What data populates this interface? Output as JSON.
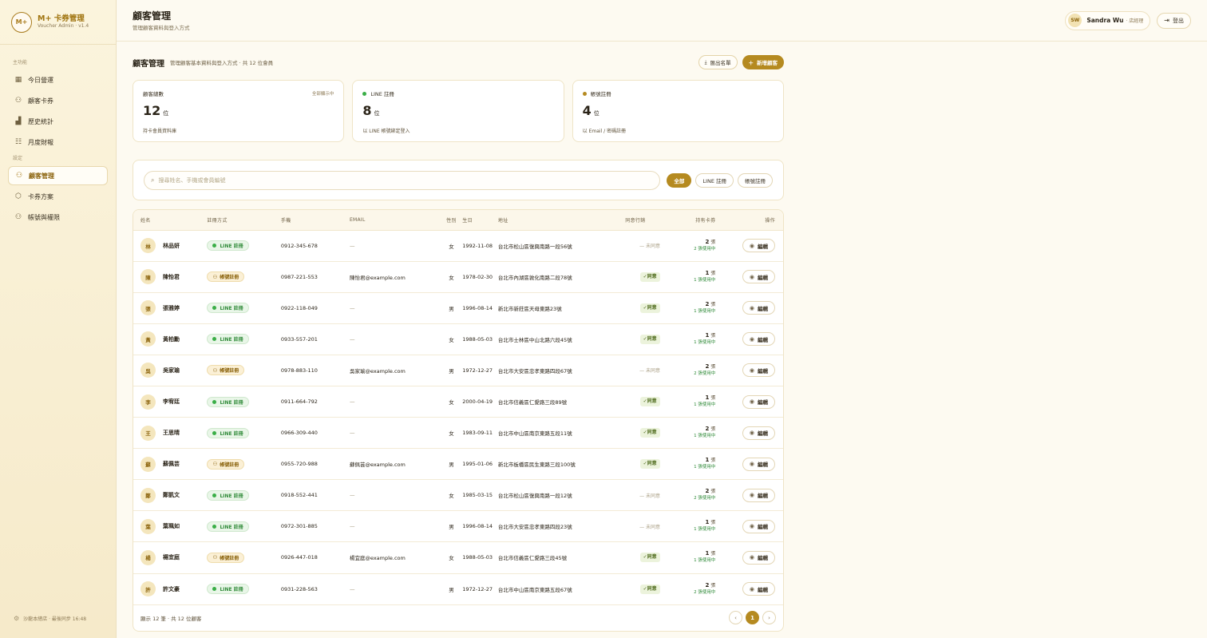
{
  "brand": {
    "logo": "M+",
    "name": "M+ 卡券管理",
    "sub": "Voucher Admin · v1.4"
  },
  "sidebar": {
    "sections": [
      {
        "title": "主功能",
        "items": [
          {
            "label": "今日營運",
            "icon": "dashboard-icon"
          },
          {
            "label": "顧客卡券",
            "icon": "users-icon"
          },
          {
            "label": "歷史統計",
            "icon": "chart-icon"
          },
          {
            "label": "月度財報",
            "icon": "report-icon"
          }
        ]
      },
      {
        "title": "設定",
        "items": [
          {
            "label": "顧客管理",
            "icon": "users-icon",
            "active": true
          },
          {
            "label": "卡券方案",
            "icon": "box-icon"
          },
          {
            "label": "帳號與權限",
            "icon": "users-icon"
          }
        ]
      }
    ],
    "footer": "沙龍本總店 · 最後同步 16:48"
  },
  "topbar": {
    "title": "顧客管理",
    "subtitle": "管理顧客資料與登入方式",
    "user_initials": "SW",
    "user_name": "Sandra Wu",
    "user_role": "· 店經理",
    "logout_label": "登出"
  },
  "section": {
    "title": "顧客管理",
    "subtitle": "管理顧客基本資料與登入方式 · 共 12 位會員",
    "export_label": "匯出名單",
    "add_label": "新增顧客"
  },
  "stats": [
    {
      "label": "顧客總數",
      "corner": "全部顯示中",
      "value": "12",
      "unit": "位",
      "desc": "持卡會員資料庫",
      "dot": ""
    },
    {
      "label": "LINE 註冊",
      "corner": "",
      "value": "8",
      "unit": "位",
      "desc": "以 LINE 帳號綁定登入",
      "dot": "#3aae47"
    },
    {
      "label": "帳號註冊",
      "corner": "",
      "value": "4",
      "unit": "位",
      "desc": "以 Email / 密碼註冊",
      "dot": "#b58a20"
    }
  ],
  "filter": {
    "search_placeholder": "搜尋姓名、手機或會員編號",
    "chips": [
      "全部",
      "LINE 註冊",
      "帳號註冊"
    ],
    "active_chip": 0
  },
  "table": {
    "headers": [
      "姓名",
      "註冊方式",
      "手機",
      "EMAIL",
      "性別",
      "生日",
      "地址",
      "同意行銷",
      "持有卡券",
      "操作"
    ],
    "line_label": "LINE 註冊",
    "acct_label": "帳號註冊",
    "consent_yes": "✓同意",
    "consent_no": "— 未同意",
    "card_unit": "張",
    "edit_label": "編輯",
    "rows": [
      {
        "initial": "林",
        "name": "林品妍",
        "reg": "line",
        "phone": "0912-345-678",
        "email": "—",
        "gender": "女",
        "birthday": "1992-11-08",
        "address": "台北市松山區復興南路一段56號",
        "consent": false,
        "cards": "2",
        "active": "2 張使用中"
      },
      {
        "initial": "陳",
        "name": "陳怡君",
        "reg": "acct",
        "phone": "0987-221-553",
        "email": "陳怡君@example.com",
        "gender": "女",
        "birthday": "1978-02-30",
        "address": "台北市內湖區敦化南路二段78號",
        "consent": true,
        "cards": "1",
        "active": "1 張使用中"
      },
      {
        "initial": "張",
        "name": "張雅婷",
        "reg": "line",
        "phone": "0922-118-049",
        "email": "—",
        "gender": "男",
        "birthday": "1996-08-14",
        "address": "新北市新莊區天母東路23號",
        "consent": true,
        "cards": "2",
        "active": "1 張使用中"
      },
      {
        "initial": "黃",
        "name": "黃柏勳",
        "reg": "line",
        "phone": "0933-557-201",
        "email": "—",
        "gender": "女",
        "birthday": "1988-05-03",
        "address": "台北市士林區中山北路六段45號",
        "consent": true,
        "cards": "1",
        "active": "1 張使用中"
      },
      {
        "initial": "吳",
        "name": "吳家瑜",
        "reg": "acct",
        "phone": "0978-883-110",
        "email": "吳家瑜@example.com",
        "gender": "男",
        "birthday": "1972-12-27",
        "address": "台北市大安區忠孝東路四段67號",
        "consent": false,
        "cards": "2",
        "active": "2 張使用中"
      },
      {
        "initial": "李",
        "name": "李宥廷",
        "reg": "line",
        "phone": "0911-664-792",
        "email": "—",
        "gender": "女",
        "birthday": "2000-04-19",
        "address": "台北市信義區仁愛路三段89號",
        "consent": true,
        "cards": "1",
        "active": "1 張使用中"
      },
      {
        "initial": "王",
        "name": "王思晴",
        "reg": "line",
        "phone": "0966-309-440",
        "email": "—",
        "gender": "女",
        "birthday": "1983-09-11",
        "address": "台北市中山區南京東路五段11號",
        "consent": true,
        "cards": "2",
        "active": "1 張使用中"
      },
      {
        "initial": "蘇",
        "name": "蘇佩芸",
        "reg": "acct",
        "phone": "0955-720-988",
        "email": "蘇佩芸@example.com",
        "gender": "男",
        "birthday": "1995-01-06",
        "address": "新北市板橋區民生東路三段100號",
        "consent": true,
        "cards": "1",
        "active": "1 張使用中"
      },
      {
        "initial": "鄭",
        "name": "鄭凱文",
        "reg": "line",
        "phone": "0918-552-441",
        "email": "—",
        "gender": "女",
        "birthday": "1985-03-15",
        "address": "台北市松山區復興南路一段12號",
        "consent": false,
        "cards": "2",
        "active": "2 張使用中"
      },
      {
        "initial": "葉",
        "name": "葉珮如",
        "reg": "line",
        "phone": "0972-301-885",
        "email": "—",
        "gender": "男",
        "birthday": "1996-08-14",
        "address": "台北市大安區忠孝東路四段23號",
        "consent": false,
        "cards": "1",
        "active": "1 張使用中"
      },
      {
        "initial": "楊",
        "name": "楊宜庭",
        "reg": "acct",
        "phone": "0926-447-018",
        "email": "楊宜庭@example.com",
        "gender": "女",
        "birthday": "1988-05-03",
        "address": "台北市信義區仁愛路三段45號",
        "consent": true,
        "cards": "1",
        "active": "1 張使用中"
      },
      {
        "initial": "許",
        "name": "許文豪",
        "reg": "line",
        "phone": "0931-228-563",
        "email": "—",
        "gender": "男",
        "birthday": "1972-12-27",
        "address": "台北市中山區南京東路五段67號",
        "consent": true,
        "cards": "2",
        "active": "2 張使用中"
      }
    ],
    "footer_info": "顯示 12 筆 · 共 12 位顧客",
    "pager": {
      "prev": "‹",
      "current": "1",
      "next": "›"
    }
  }
}
